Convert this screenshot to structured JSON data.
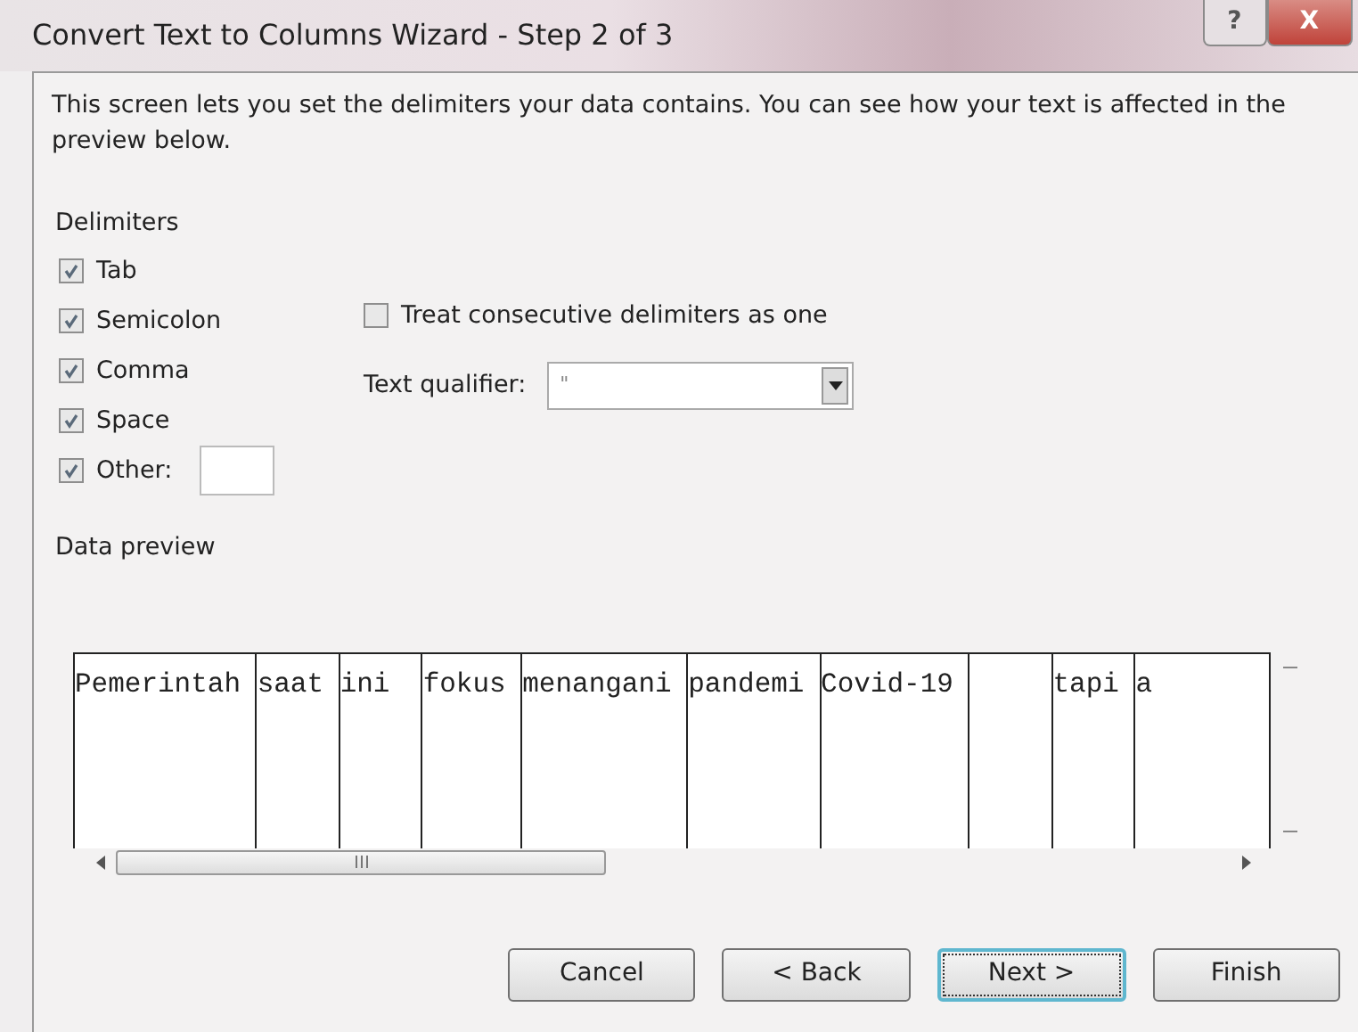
{
  "window": {
    "title": "Convert Text to Columns Wizard - Step 2 of 3",
    "buttons": [
      {
        "kind": "help",
        "label": "?"
      },
      {
        "kind": "close",
        "label": "X"
      }
    ]
  },
  "description": "This screen lets you set the delimiters your data contains.  You can see how your text is affected in the preview below.",
  "delimiters": {
    "title": "Delimiters",
    "items": [
      {
        "label": "Tab",
        "checked": true
      },
      {
        "label": "Semicolon",
        "checked": true
      },
      {
        "label": "Comma",
        "checked": true
      },
      {
        "label": "Space",
        "checked": true
      },
      {
        "label": "Other:",
        "checked": true,
        "kind": "other"
      }
    ]
  },
  "treat_consecutive": {
    "label": "Treat consecutive delimiters as one",
    "checked": false
  },
  "text_qualifier": {
    "label": "Text qualifier:",
    "value": "\""
  },
  "data_preview": {
    "title": "Data preview",
    "columns": [
      {
        "text": "Pemerintah"
      },
      {
        "text": "saat"
      },
      {
        "text": "ini"
      },
      {
        "text": "fokus"
      },
      {
        "text": "menangani"
      },
      {
        "text": "pandemi"
      },
      {
        "text": "Covid-19"
      },
      {
        "kind": "empty"
      },
      {
        "text": "tapi"
      },
      {
        "text": "a",
        "kind": "cut"
      }
    ]
  },
  "buttons": [
    {
      "label": "Cancel",
      "selected": false
    },
    {
      "label": "< Back",
      "selected": false
    },
    {
      "label": "Next >",
      "selected": true
    },
    {
      "label": "Finish",
      "selected": false
    }
  ]
}
